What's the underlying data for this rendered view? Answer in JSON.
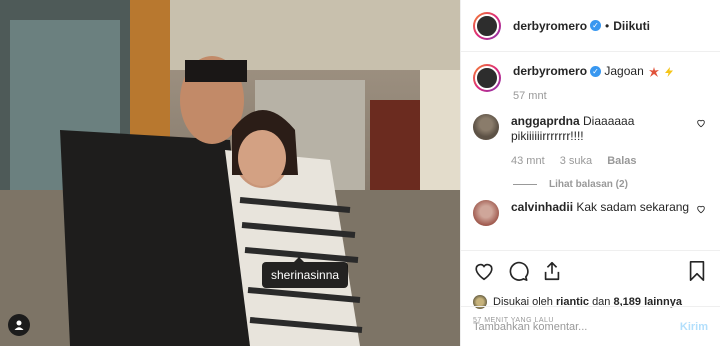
{
  "header": {
    "username": "derbyromero",
    "follow_status": "Diikuti"
  },
  "caption": {
    "username": "derbyromero",
    "text": "Jagoan",
    "emojis": [
      "collision-emoji",
      "lightning-emoji"
    ],
    "time": "57 mnt"
  },
  "comments": [
    {
      "username": "anggaprdna",
      "text": "Diaaaaaa pikiiiiiirrrrrrr!!!!",
      "time": "43 mnt",
      "likes": "3 suka",
      "reply_label": "Balas",
      "view_replies": "Lihat balasan (2)"
    },
    {
      "username": "calvinhadii",
      "text": "Kak sadam sekarang"
    }
  ],
  "photo": {
    "tag_label": "sherinasinna"
  },
  "likes": {
    "prefix": "Disukai oleh",
    "user": "riantic",
    "connector": "dan",
    "count_text": "8,189 lainnya"
  },
  "post_time": "57 MENIT YANG LALU",
  "comment_box": {
    "placeholder": "Tambahkan komentar...",
    "send_label": "Kirim"
  },
  "icons": [
    "heart-icon",
    "comment-icon",
    "share-icon",
    "bookmark-icon",
    "user-tag-icon",
    "verified-badge-icon",
    "comment-like-icon"
  ]
}
